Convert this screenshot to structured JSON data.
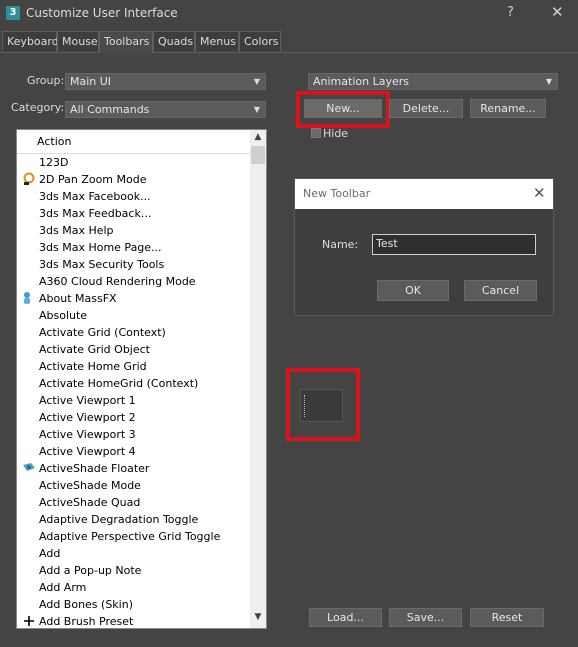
{
  "window": {
    "app_icon_label": "3",
    "title": "Customize User Interface",
    "help_glyph": "?",
    "close_glyph": "✕"
  },
  "tabs": [
    {
      "label": "Keyboard",
      "active": false
    },
    {
      "label": "Mouse",
      "active": false
    },
    {
      "label": "Toolbars",
      "active": true
    },
    {
      "label": "Quads",
      "active": false
    },
    {
      "label": "Menus",
      "active": false
    },
    {
      "label": "Colors",
      "active": false
    }
  ],
  "group": {
    "label": "Group:",
    "value": "Main UI"
  },
  "category": {
    "label": "Category:",
    "value": "All Commands"
  },
  "action_list": {
    "header": "Action",
    "items": [
      {
        "label": "123D",
        "icon": ""
      },
      {
        "label": "2D Pan Zoom Mode",
        "icon": "pan-zoom-icon"
      },
      {
        "label": "3ds Max Facebook...",
        "icon": ""
      },
      {
        "label": "3ds Max Feedback...",
        "icon": ""
      },
      {
        "label": "3ds Max Help",
        "icon": ""
      },
      {
        "label": "3ds Max Home Page...",
        "icon": ""
      },
      {
        "label": "3ds Max Security Tools",
        "icon": ""
      },
      {
        "label": "A360 Cloud Rendering Mode",
        "icon": ""
      },
      {
        "label": "About MassFX",
        "icon": "massfx-icon"
      },
      {
        "label": "Absolute",
        "icon": ""
      },
      {
        "label": "Activate Grid (Context)",
        "icon": ""
      },
      {
        "label": "Activate Grid Object",
        "icon": ""
      },
      {
        "label": "Activate Home Grid",
        "icon": ""
      },
      {
        "label": "Activate HomeGrid (Context)",
        "icon": ""
      },
      {
        "label": "Active Viewport 1",
        "icon": ""
      },
      {
        "label": "Active Viewport 2",
        "icon": ""
      },
      {
        "label": "Active Viewport 3",
        "icon": ""
      },
      {
        "label": "Active Viewport 4",
        "icon": ""
      },
      {
        "label": "ActiveShade Floater",
        "icon": "activeshade-icon"
      },
      {
        "label": "ActiveShade Mode",
        "icon": ""
      },
      {
        "label": "ActiveShade Quad",
        "icon": ""
      },
      {
        "label": "Adaptive Degradation Toggle",
        "icon": ""
      },
      {
        "label": "Adaptive Perspective Grid Toggle",
        "icon": ""
      },
      {
        "label": "Add",
        "icon": ""
      },
      {
        "label": "Add a Pop-up Note",
        "icon": ""
      },
      {
        "label": "Add Arm",
        "icon": ""
      },
      {
        "label": "Add Bones (Skin)",
        "icon": ""
      },
      {
        "label": "Add Brush Preset",
        "icon": "plus-icon"
      }
    ],
    "scroll_up": "▲",
    "scroll_down": "▼"
  },
  "toolbar_select": {
    "value": "Animation Layers"
  },
  "buttons": {
    "new": "New...",
    "delete": "Delete...",
    "rename": "Rename..."
  },
  "hide_label": "Hide",
  "dialog": {
    "title": "New Toolbar",
    "close_glyph": "✕",
    "name_label": "Name:",
    "name_value": "Test",
    "ok": "OK",
    "cancel": "Cancel"
  },
  "bottom_buttons": {
    "load": "Load...",
    "save": "Save...",
    "reset": "Reset"
  },
  "colors": {
    "background": "#444444",
    "highlight": "#d8131c",
    "list_bg": "#ffffff"
  }
}
